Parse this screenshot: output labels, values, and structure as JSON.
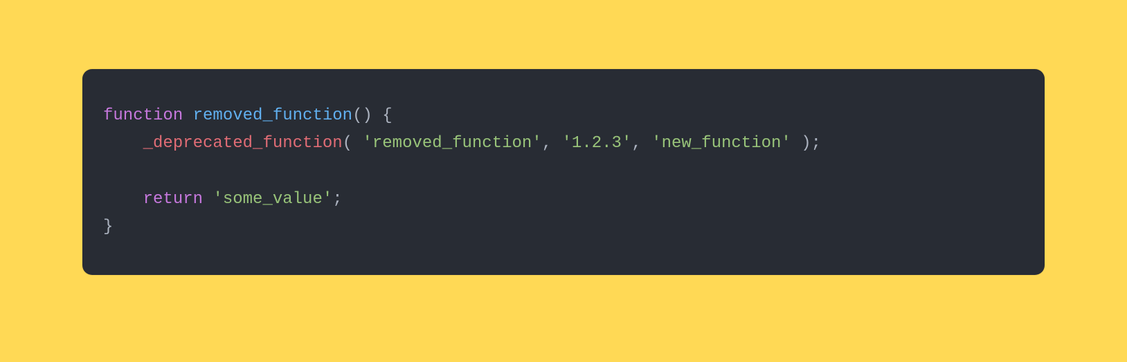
{
  "code": {
    "line1": {
      "kw_function": "function",
      "space1": " ",
      "fn_name": "removed_function",
      "parens": "()",
      "space2": " ",
      "brace_open": "{"
    },
    "line2": {
      "indent": "    ",
      "call_name": "_deprecated_function",
      "open": "( ",
      "arg1": "'removed_function'",
      "sep1": ", ",
      "arg2": "'1.2.3'",
      "sep2": ", ",
      "arg3": "'new_function'",
      "close": " );"
    },
    "line3": {
      "blank": ""
    },
    "line4": {
      "indent": "    ",
      "kw_return": "return",
      "space": " ",
      "value": "'some_value'",
      "semi": ";"
    },
    "line5": {
      "brace_close": "}"
    }
  },
  "colors": {
    "page_bg": "#ffd955",
    "code_bg": "#282c34",
    "text_default": "#abb2bf",
    "keyword": "#c678dd",
    "function_def": "#61afef",
    "function_call": "#e06c75",
    "string": "#98c379"
  }
}
